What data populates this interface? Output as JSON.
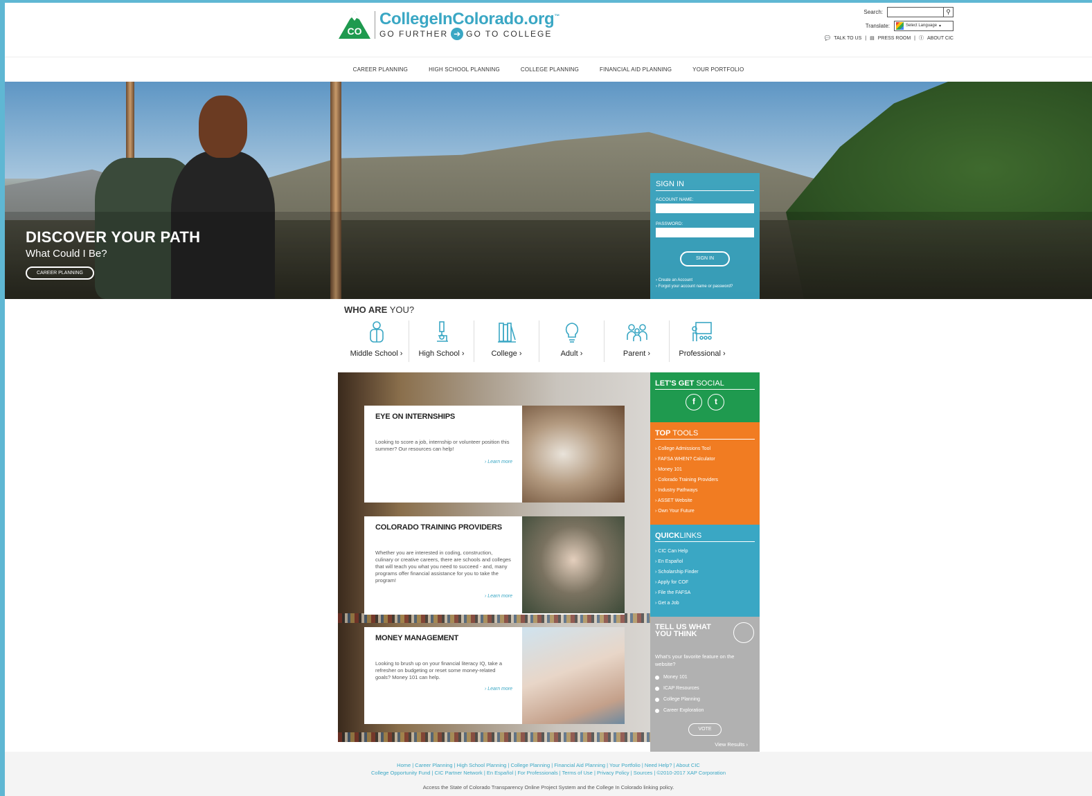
{
  "header": {
    "logo_name": "CollegeInColorado.org",
    "logo_tagline_left": "GO FURTHER",
    "logo_tagline_right": "GO TO COLLEGE",
    "logo_badge": "CO",
    "search_label": "Search:",
    "search_value": "",
    "translate_label": "Translate:",
    "language_select": "Select Language",
    "util_links": [
      "TALK TO US",
      "PRESS ROOM",
      "ABOUT CIC"
    ]
  },
  "nav": [
    "CAREER PLANNING",
    "HIGH SCHOOL PLANNING",
    "COLLEGE PLANNING",
    "FINANCIAL AID PLANNING",
    "YOUR PORTFOLIO"
  ],
  "hero": {
    "title": "DISCOVER YOUR PATH",
    "subtitle": "What Could I Be?",
    "button": "CAREER PLANNING"
  },
  "signin": {
    "title": "SIGN IN",
    "account_label": "ACCOUNT NAME:",
    "password_label": "PASSWORD:",
    "button": "SIGN IN",
    "link_create": "› Create an Account",
    "link_forgot": "› Forgot your account name or password?"
  },
  "who": {
    "title_bold": "WHO ARE",
    "title_rest": " YOU?",
    "audiences": [
      "Middle School ›",
      "High School ›",
      "College ›",
      "Adult ›",
      "Parent ›",
      "Professional ›"
    ]
  },
  "features": [
    {
      "title": "EYE ON INTERNSHIPS",
      "body": "Looking to score a job, internship or volunteer position this summer? Our resources can help!",
      "more": "› Learn more"
    },
    {
      "title": "COLORADO TRAINING PROVIDERS",
      "body": "Whether you are interested in coding, construction, culinary or creative careers, there are schools and colleges that will teach you what you need to succeed - and, many programs offer financial assistance for you to take the program!",
      "more": "› Learn more"
    },
    {
      "title": "MONEY MANAGEMENT",
      "body": "Looking to brush up on your financial literacy IQ, take a refresher on budgeting or reset some money-related goals? Money 101 can help.",
      "more": "› Learn more"
    }
  ],
  "social": {
    "title_bold": "LET'S GET",
    "title_rest": " SOCIAL",
    "icons": [
      "f",
      "t"
    ]
  },
  "tools": {
    "title_bold": "TOP",
    "title_rest": " TOOLS",
    "items": [
      "› College Admissions Tool",
      "› FAFSA WHEN? Calculator",
      "› Money 101",
      "› Colorado Training Providers",
      "› Industry Pathways",
      "› ASSET Website",
      "› Own Your Future"
    ]
  },
  "quick": {
    "title_bold": "QUICK",
    "title_rest": "LINKS",
    "items": [
      "› CIC Can Help",
      "› En Español",
      "› Scholarship Finder",
      "› Apply for COF",
      "› File the FAFSA",
      "› Get a Job"
    ]
  },
  "tell": {
    "title": "TELL US WHAT YOU THINK",
    "question": "What's your favorite feature on the website?",
    "options": [
      "Money 101",
      "ICAP Resources",
      "College Planning",
      "Career Exploration"
    ],
    "vote": "VOTE",
    "results": "View Results ›"
  },
  "footer": {
    "line1": "Home | Career Planning | High School Planning | College Planning | Financial Aid Planning | Your Portfolio | Need Help? | About CIC",
    "line2": "College Opportunity Fund | CIC Partner Network | En Español | For Professionals | Terms of Use | Privacy Policy | Sources | ©2010-2017 XAP Corporation",
    "line3": "Access the State of Colorado Transparency Online Project System and the College In Colorado linking policy."
  },
  "colors": {
    "brand_blue": "#3aa7c4",
    "brand_green": "#1f9a4f",
    "orange": "#f17c22",
    "gray": "#b1b1b1"
  }
}
